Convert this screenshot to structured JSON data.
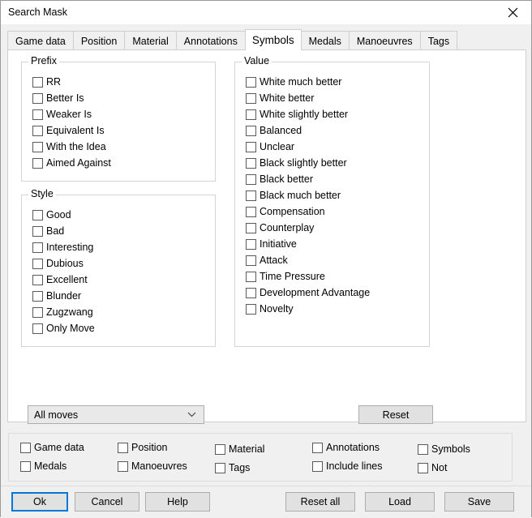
{
  "window": {
    "title": "Search Mask",
    "close_icon": "close-icon"
  },
  "tabs": [
    {
      "label": "Game data",
      "active": false
    },
    {
      "label": "Position",
      "active": false
    },
    {
      "label": "Material",
      "active": false
    },
    {
      "label": "Annotations",
      "active": false
    },
    {
      "label": "Symbols",
      "active": true
    },
    {
      "label": "Medals",
      "active": false
    },
    {
      "label": "Manoeuvres",
      "active": false
    },
    {
      "label": "Tags",
      "active": false
    }
  ],
  "groups": {
    "prefix": {
      "title": "Prefix",
      "items": [
        {
          "label": "RR",
          "checked": false
        },
        {
          "label": "Better Is",
          "checked": false
        },
        {
          "label": "Weaker Is",
          "checked": false
        },
        {
          "label": "Equivalent Is",
          "checked": false
        },
        {
          "label": "With the Idea",
          "checked": false
        },
        {
          "label": "Aimed Against",
          "checked": false
        }
      ]
    },
    "style": {
      "title": "Style",
      "items": [
        {
          "label": "Good",
          "checked": false
        },
        {
          "label": "Bad",
          "checked": false
        },
        {
          "label": "Interesting",
          "checked": false
        },
        {
          "label": "Dubious",
          "checked": false
        },
        {
          "label": "Excellent",
          "checked": false
        },
        {
          "label": "Blunder",
          "checked": false
        },
        {
          "label": "Zugzwang",
          "checked": false
        },
        {
          "label": "Only Move",
          "checked": false
        }
      ]
    },
    "value": {
      "title": "Value",
      "items": [
        {
          "label": "White much better",
          "checked": false
        },
        {
          "label": "White better",
          "checked": false
        },
        {
          "label": "White slightly better",
          "checked": false
        },
        {
          "label": "Balanced",
          "checked": false
        },
        {
          "label": "Unclear",
          "checked": false
        },
        {
          "label": "Black slightly better",
          "checked": false
        },
        {
          "label": "Black better",
          "checked": false
        },
        {
          "label": "Black much better",
          "checked": false
        },
        {
          "label": "Compensation",
          "checked": false
        },
        {
          "label": "Counterplay",
          "checked": false
        },
        {
          "label": "Initiative",
          "checked": false
        },
        {
          "label": "Attack",
          "checked": false
        },
        {
          "label": "Time Pressure",
          "checked": false
        },
        {
          "label": "Development Advantage",
          "checked": false
        },
        {
          "label": "Novelty",
          "checked": false
        }
      ]
    }
  },
  "moves_combo": {
    "value": "All moves",
    "arrow_icon": "chevron-down-icon"
  },
  "reset_button": {
    "label": "Reset"
  },
  "bottom_filters": [
    {
      "label": "Game data",
      "checked": false
    },
    {
      "label": "Position",
      "checked": false
    },
    {
      "label": "Material",
      "checked": false
    },
    {
      "label": "Annotations",
      "checked": false
    },
    {
      "label": "Symbols",
      "checked": false
    },
    {
      "label": "Medals",
      "checked": false
    },
    {
      "label": "Manoeuvres",
      "checked": false
    },
    {
      "label": "Tags",
      "checked": false
    },
    {
      "label": "Include lines",
      "checked": false
    },
    {
      "label": "Not",
      "checked": false
    }
  ],
  "buttons": {
    "ok": "Ok",
    "cancel": "Cancel",
    "help": "Help",
    "reset_all": "Reset all",
    "load": "Load",
    "save": "Save"
  },
  "colors": {
    "focus_outline": "#0078d7",
    "panel_bg": "#f0f0f0",
    "content_bg": "#ffffff",
    "button_bg": "#e1e1e1",
    "border": "#cfcfcf"
  }
}
